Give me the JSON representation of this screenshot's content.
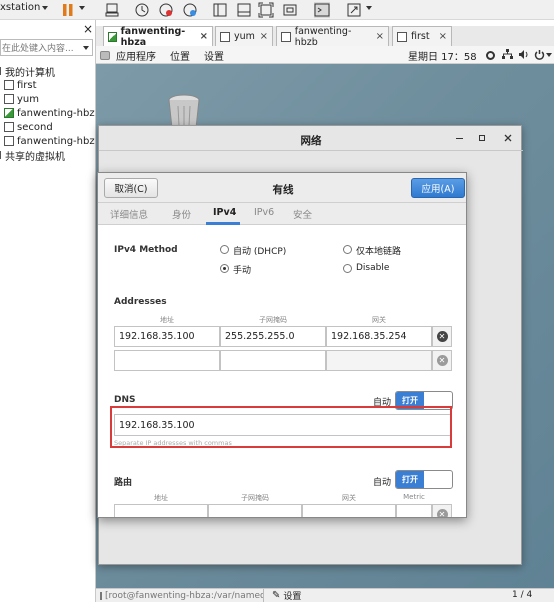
{
  "toolbar": {
    "title": "xstation"
  },
  "library": {
    "search_placeholder": "在此处键入内容...",
    "close": "×",
    "my_computer": "我的计算机",
    "vms": [
      "first",
      "yum",
      "fanwenting-hbz",
      "second",
      "fanwenting-hbz"
    ],
    "shared": "共享的虚拟机"
  },
  "tabs": [
    {
      "label": "fanwenting-hbza",
      "close": "×"
    },
    {
      "label": "yum",
      "close": "×"
    },
    {
      "label": "fanwenting-hbzb",
      "close": "×"
    },
    {
      "label": "first",
      "close": "×"
    }
  ],
  "gnome": {
    "apps": "应用程序",
    "places": "位置",
    "settings": "设置",
    "clock": "星期日 17：58"
  },
  "network_window": {
    "title": "网络"
  },
  "dialog": {
    "cancel": "取消(C)",
    "title": "有线",
    "apply": "应用(A)",
    "tabs": [
      "详细信息",
      "身份",
      "IPv4",
      "IPv6",
      "安全"
    ],
    "method_label": "IPv4 Method",
    "methods": [
      "自动 (DHCP)",
      "仅本地链路",
      "手动",
      "Disable"
    ],
    "addresses_label": "Addresses",
    "col_address": "地址",
    "col_netmask": "子网掩码",
    "col_gateway": "网关",
    "address": "192.168.35.100",
    "netmask": "255.255.255.0",
    "gateway": "192.168.35.254",
    "dns_label": "DNS",
    "auto_label": "自动",
    "toggle_on": "打开",
    "dns_value": "192.168.35.100",
    "dns_hint": "Separate IP addresses with commas",
    "routes_label": "路由",
    "route_auto": "自动",
    "route_toggle": "打开",
    "route_col_address": "地址",
    "route_col_netmask": "子网掩码",
    "route_col_gateway": "网关",
    "route_col_metric": "Metric"
  },
  "status": {
    "terminal": "[root@fanwenting-hbza:/var/named]",
    "settings": "设置",
    "pager": "1 / 4"
  },
  "colors": {
    "accent": "#3b7fd4",
    "highlight": "#d93a3a"
  }
}
